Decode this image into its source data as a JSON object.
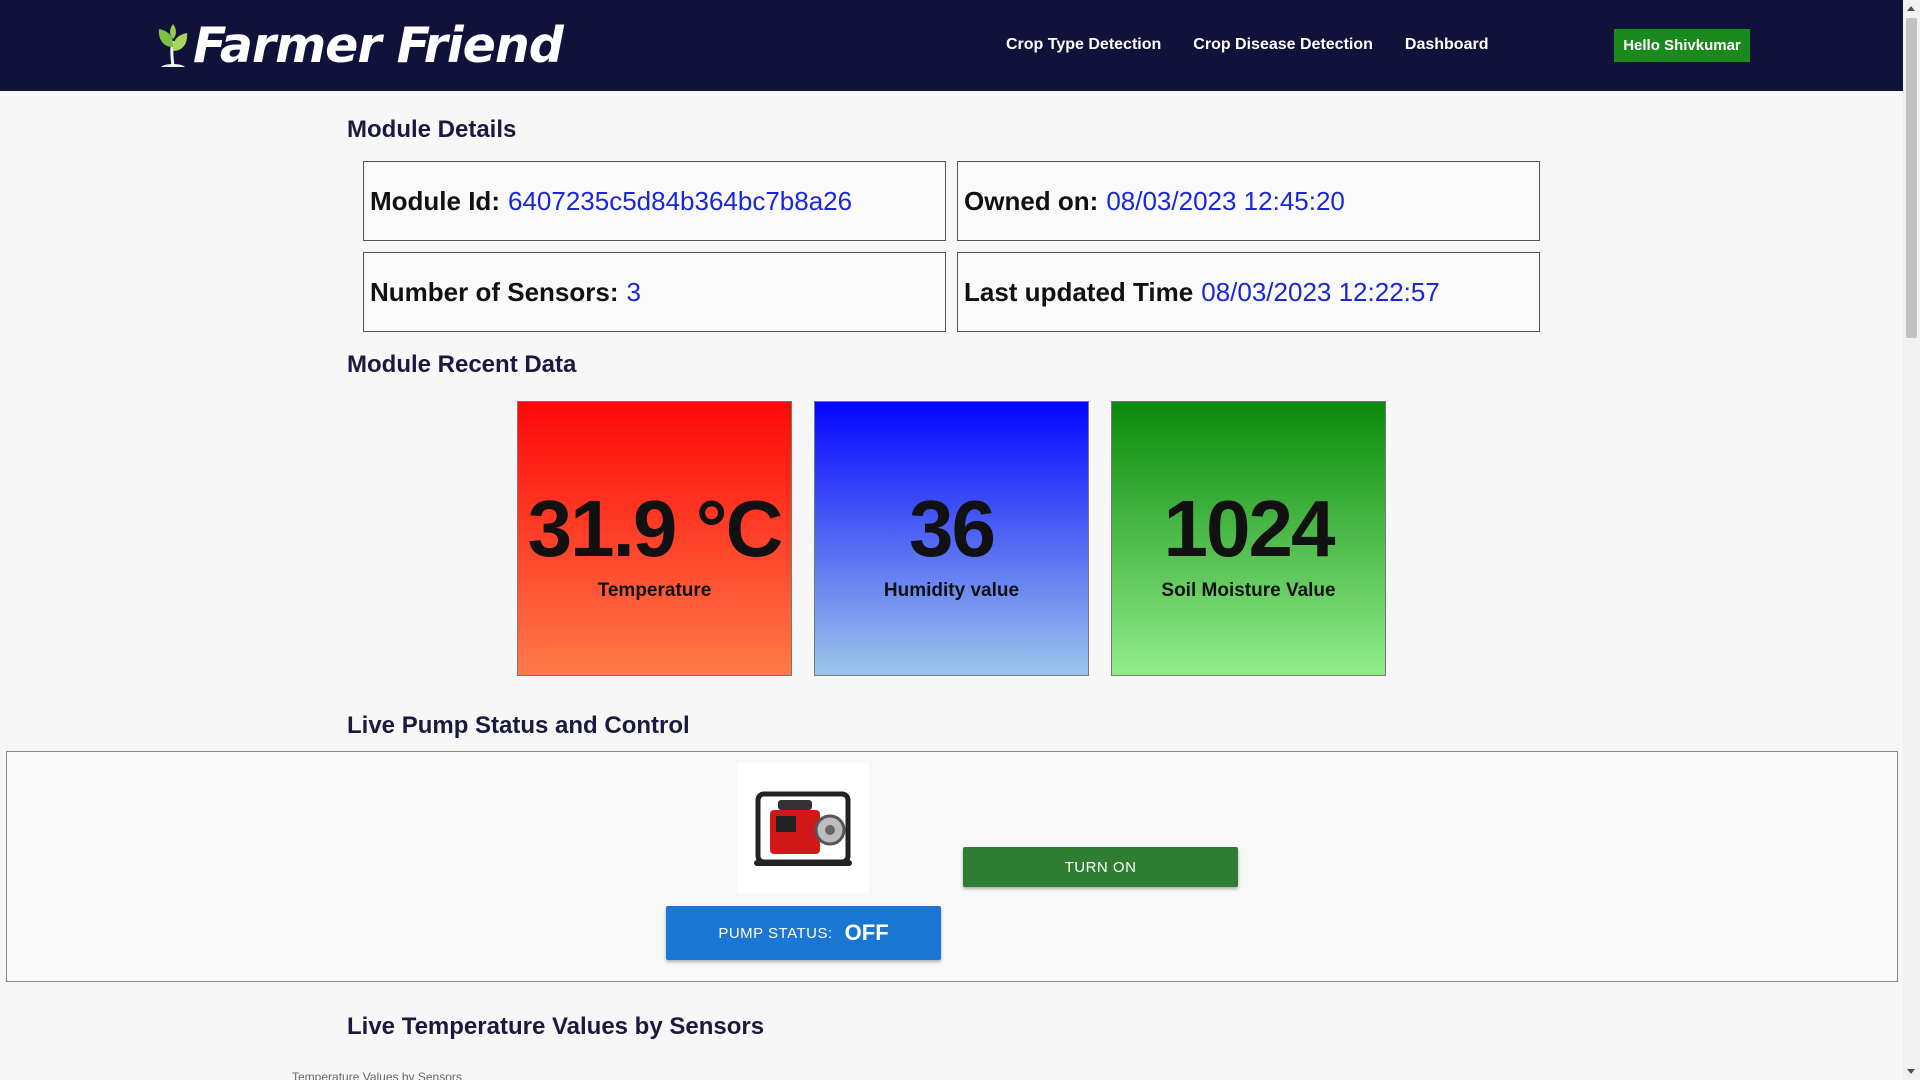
{
  "navbar": {
    "brand": "Farmer Friend",
    "links": [
      "Crop Type Detection",
      "Crop Disease Detection",
      "Dashboard"
    ],
    "user_button": "Hello Shivkumar",
    "logo_icon": "leaf-icon"
  },
  "module_details": {
    "title": "Module Details",
    "module_id_label": "Module Id:",
    "module_id": "6407235c5d84b364bc7b8a26",
    "owned_on_label": "Owned on:",
    "owned_on": "08/03/2023 12:45:20",
    "sensors_label": "Number of Sensors:",
    "sensors": "3",
    "last_updated_label": "Last updated Time",
    "last_updated": "08/03/2023 12:22:57"
  },
  "recent_data": {
    "title": "Module Recent Data",
    "cards": [
      {
        "value": "31.9 °C",
        "label": "Temperature",
        "color": "#ff0808"
      },
      {
        "value": "36",
        "label": "Humidity value",
        "color": "#0505ff"
      },
      {
        "value": "1024",
        "label": "Soil Moisture Value",
        "color": "#0a8a0a"
      }
    ]
  },
  "pump": {
    "title": "Live Pump Status and Control",
    "turn_on_label": "TURN ON",
    "status_label": "PUMP STATUS:",
    "status_value": "OFF",
    "image_icon": "water-pump-image"
  },
  "temperature_section": {
    "title": "Live Temperature Values by Sensors",
    "chart_caption": "Temperature Values by Sensors"
  },
  "colors": {
    "navbar_bg": "#11123a",
    "accent_green": "#1b8a1e",
    "value_blue": "#1a27d8",
    "status_blue": "#1976d2"
  }
}
